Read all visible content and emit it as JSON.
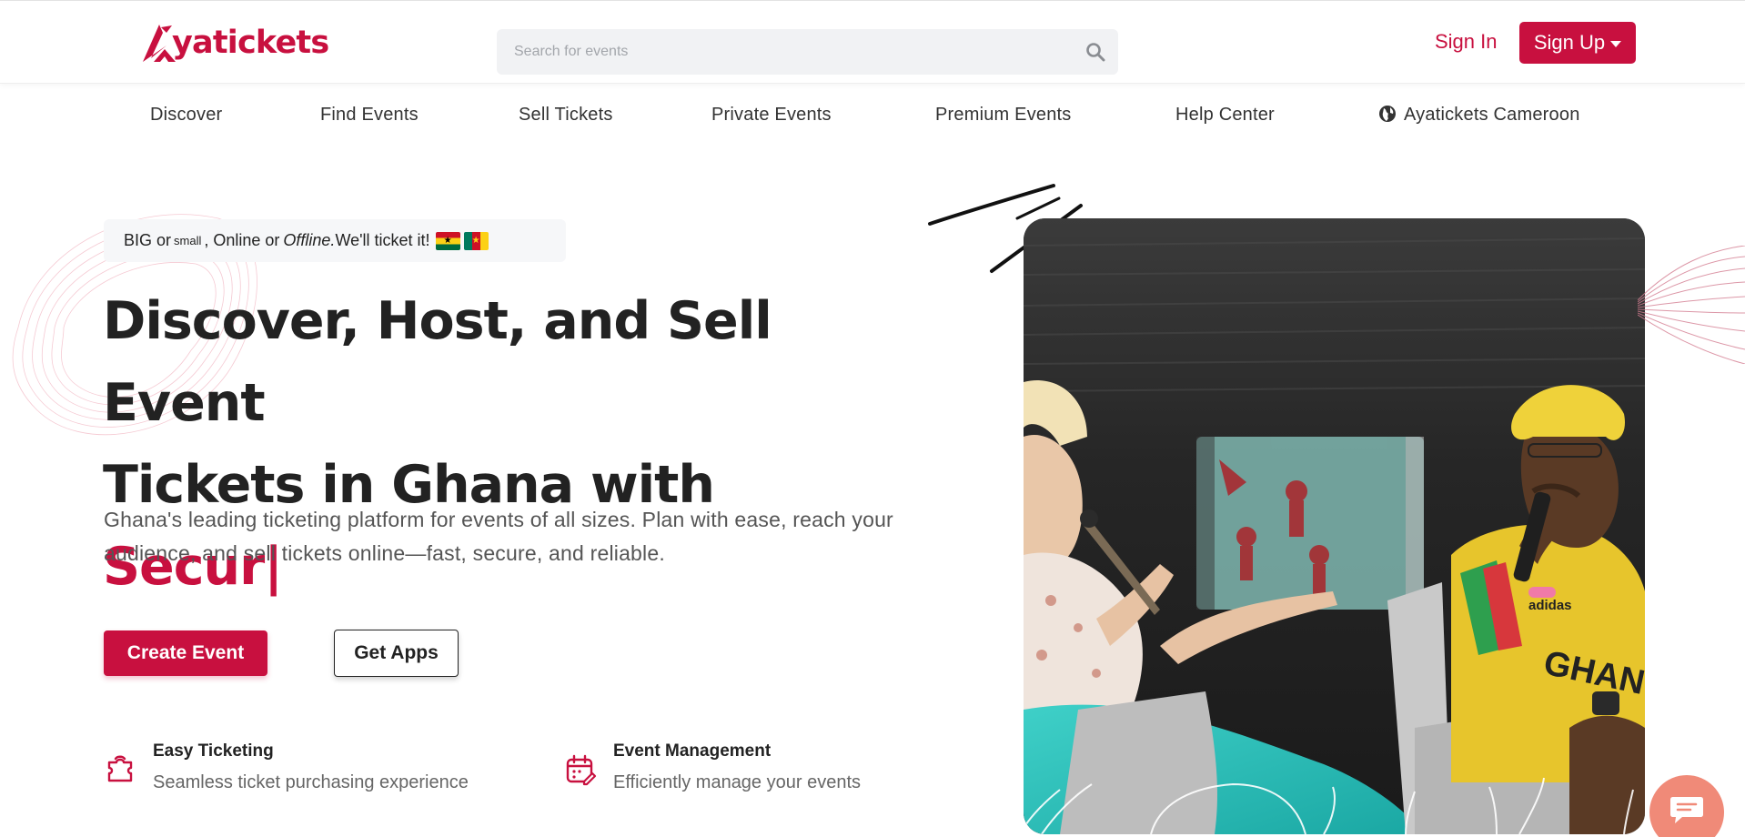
{
  "brand": {
    "name": "yatickets",
    "accent": "#c8103f"
  },
  "search": {
    "placeholder": "Search for events",
    "value": ""
  },
  "auth": {
    "sign_in": "Sign In",
    "sign_up": "Sign Up"
  },
  "nav": {
    "items": [
      {
        "label": "Discover"
      },
      {
        "label": "Find Events"
      },
      {
        "label": "Sell Tickets"
      },
      {
        "label": "Private Events"
      },
      {
        "label": "Premium Events"
      },
      {
        "label": "Help Center"
      },
      {
        "label": "Ayatickets Cameroon",
        "icon": "globe-icon"
      }
    ]
  },
  "hero": {
    "tagline": {
      "part1": "BIG or",
      "small": "small",
      "part2": ", Online or",
      "italic": "Offline.",
      "part3": " We'll ticket it!"
    },
    "headline": {
      "line1": "Discover, Host, and Sell Event",
      "line2": "Tickets in Ghana with ",
      "typed": "Secur",
      "cursor": "|"
    },
    "description": "Ghana's leading ticketing platform for events of all sizes. Plan with ease, reach your audience, and sell tickets online—fast, secure, and reliable.",
    "primary_button": "Create Event",
    "secondary_button": "Get Apps"
  },
  "features": [
    {
      "icon": "ticket-icon",
      "title": "Easy Ticketing",
      "description": "Seamless ticket purchasing experience"
    },
    {
      "icon": "calendar-edit-icon",
      "title": "Event Management",
      "description": "Efficiently manage your events"
    }
  ],
  "colors": {
    "accent": "#c8103f",
    "text": "#222222",
    "muted": "#666666",
    "search_bg": "#f1f2f4",
    "chat_bubble": "#f08a78"
  }
}
